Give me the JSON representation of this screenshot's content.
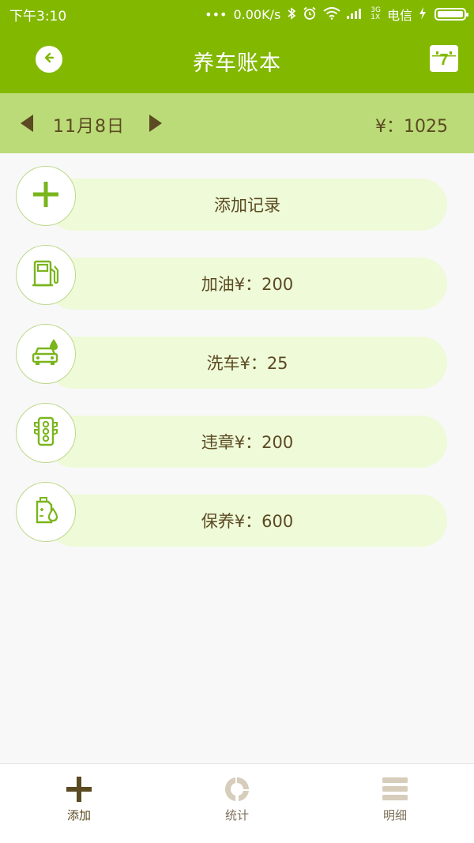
{
  "status_bar": {
    "time": "下午3:10",
    "dots": "•••",
    "speed": "0.00K/s",
    "network": "3G\n1X",
    "carrier": "电信"
  },
  "app_bar": {
    "title": "养车账本",
    "back_icon": "back-arrow-icon",
    "calendar_icon": "calendar-icon",
    "calendar_day": "7"
  },
  "date_bar": {
    "date": "11月8日",
    "total": "¥：1025"
  },
  "records": [
    {
      "label": "添加记录",
      "icon": "plus-icon"
    },
    {
      "label": "加油¥：200",
      "icon": "fuel-pump-icon"
    },
    {
      "label": "洗车¥：25",
      "icon": "car-wash-icon"
    },
    {
      "label": "违章¥：200",
      "icon": "traffic-light-icon"
    },
    {
      "label": "保养¥：600",
      "icon": "oil-can-icon"
    }
  ],
  "bottom_nav": [
    {
      "label": "添加",
      "icon": "plus-icon",
      "active": true
    },
    {
      "label": "统计",
      "icon": "ring-chart-icon",
      "active": false
    },
    {
      "label": "明细",
      "icon": "menu-lines-icon",
      "active": false
    }
  ],
  "colors": {
    "primary": "#82b800",
    "date_bar": "#bbdb78",
    "pill": "#eefad8",
    "text_dark": "#5b4a22",
    "inactive": "#d6cdbb"
  }
}
